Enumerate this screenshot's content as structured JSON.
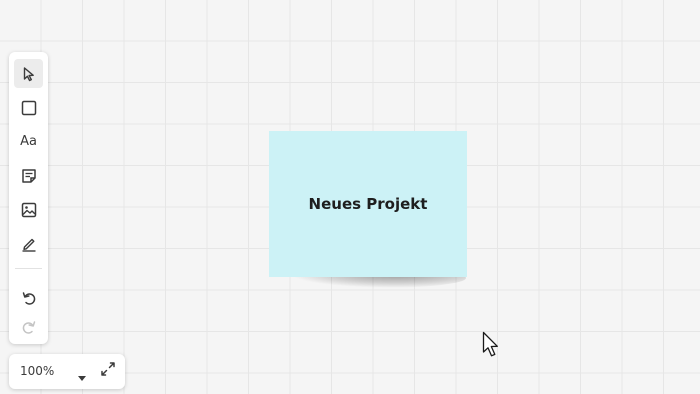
{
  "toolbar": {
    "tools": [
      {
        "name": "select",
        "icon": "pointer-icon",
        "active": true
      },
      {
        "name": "shape",
        "icon": "square-icon",
        "active": false
      },
      {
        "name": "text",
        "icon": "text-icon",
        "label": "Aa",
        "active": false
      },
      {
        "name": "sticky-note",
        "icon": "sticky-note-icon",
        "active": false
      },
      {
        "name": "image",
        "icon": "image-icon",
        "active": false
      },
      {
        "name": "pen",
        "icon": "pen-icon",
        "active": false
      }
    ],
    "history": [
      {
        "name": "undo",
        "icon": "undo-icon",
        "enabled": true
      },
      {
        "name": "redo",
        "icon": "redo-icon",
        "enabled": false
      }
    ]
  },
  "zoom": {
    "value": "100%",
    "caret_icon": "caret-down-icon",
    "fit_icon": "expand-icon"
  },
  "canvas": {
    "sticky_note": {
      "text": "Neues Projekt",
      "color": "#ccf2f6"
    }
  },
  "colors": {
    "background": "#f5f5f5",
    "grid": "#e6e6e6",
    "panel": "#ffffff",
    "icon": "#3b3b3b",
    "icon_disabled": "#c4c4c4"
  }
}
